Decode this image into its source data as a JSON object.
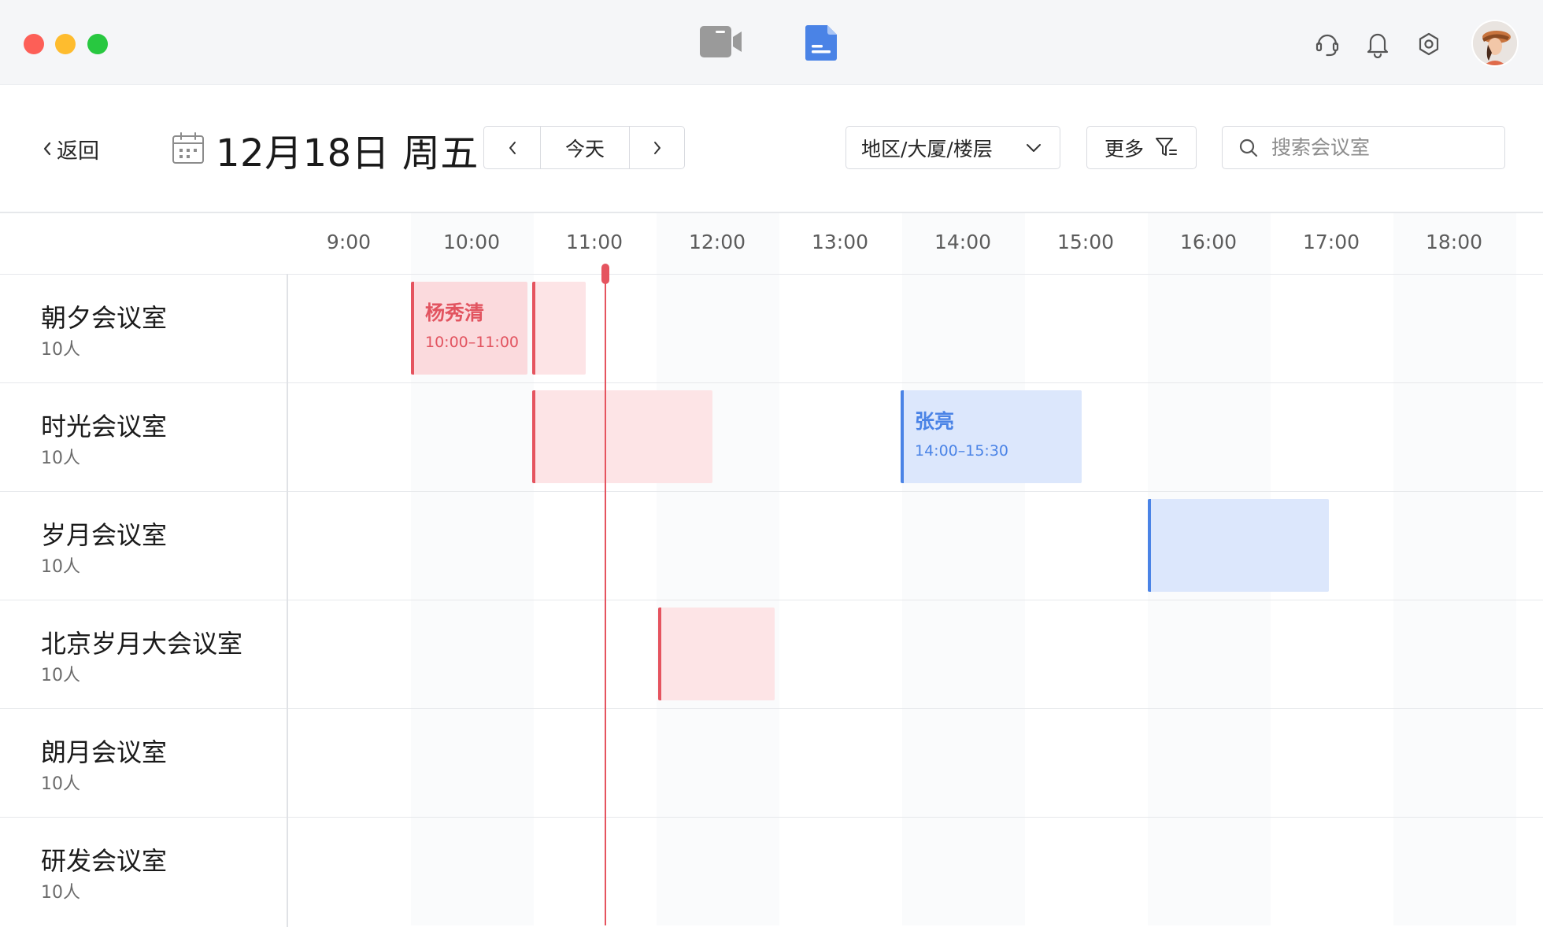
{
  "titlebar": {
    "center_icons": [
      "video-camera-icon",
      "document-icon"
    ],
    "right_icons": [
      "headset-icon",
      "bell-icon",
      "gear-icon"
    ],
    "avatar": "user-avatar"
  },
  "toolbar": {
    "back_label": "返回",
    "date_title": "12月18日 周五",
    "prev_icon": "chevron-left-icon",
    "today_label": "今天",
    "next_icon": "chevron-right-icon",
    "region_label": "地区/大厦/楼层",
    "more_label": "更多",
    "search_placeholder": "搜索会议室"
  },
  "schedule": {
    "hours": [
      "9:00",
      "10:00",
      "11:00",
      "12:00",
      "13:00",
      "14:00",
      "15:00",
      "16:00",
      "17:00",
      "18:00"
    ],
    "current_time": "11:10",
    "rooms": [
      {
        "name": "朝夕会议室",
        "capacity": "10人"
      },
      {
        "name": "时光会议室",
        "capacity": "10人"
      },
      {
        "name": "岁月会议室",
        "capacity": "10人"
      },
      {
        "name": "北京岁月大会议室",
        "capacity": "10人"
      },
      {
        "name": "朗月会议室",
        "capacity": "10人"
      },
      {
        "name": "研发会议室",
        "capacity": "10人"
      }
    ],
    "bookings": [
      {
        "room": 0,
        "organizer": "杨秀清",
        "time": "10:00–11:00",
        "color": "red"
      },
      {
        "room": 0,
        "organizer": "",
        "time": "",
        "color": "red"
      },
      {
        "room": 1,
        "organizer": "",
        "time": "",
        "color": "red"
      },
      {
        "room": 1,
        "organizer": "张亮",
        "time": "14:00–15:30",
        "color": "blue"
      },
      {
        "room": 2,
        "organizer": "",
        "time": "",
        "color": "blue"
      },
      {
        "room": 3,
        "organizer": "",
        "time": "",
        "color": "red"
      }
    ]
  },
  "colors": {
    "red_accent": "#e5545f",
    "red_fill": "#fde4e6",
    "blue_accent": "#4a83e6",
    "blue_fill": "#dce7fc",
    "doc_icon": "#4a83e6"
  }
}
